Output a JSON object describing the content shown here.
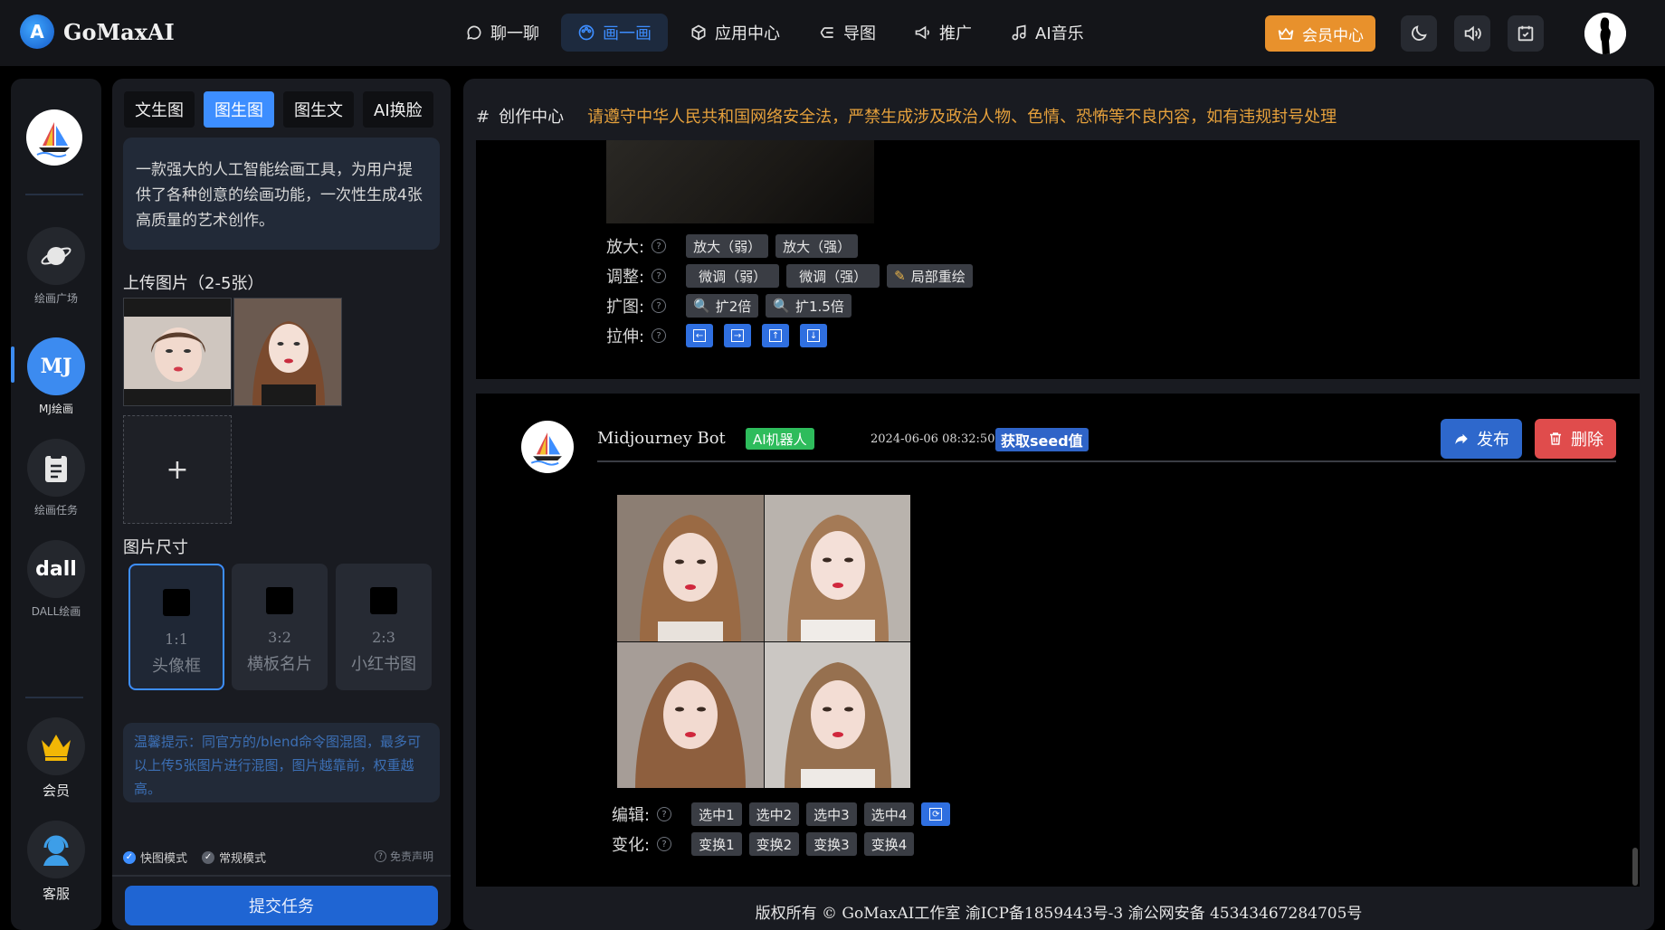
{
  "brand": {
    "name": "GoMaxAI"
  },
  "nav": {
    "items": [
      {
        "label": "聊一聊",
        "icon": "chat-icon"
      },
      {
        "label": "画一画",
        "icon": "palette-icon",
        "active": true
      },
      {
        "label": "应用中心",
        "icon": "cube-icon"
      },
      {
        "label": "导图",
        "icon": "mindmap-icon"
      },
      {
        "label": "推广",
        "icon": "megaphone-icon"
      },
      {
        "label": "AI音乐",
        "icon": "music-icon"
      }
    ],
    "vip_label": "会员中心"
  },
  "rail": {
    "items": [
      {
        "label": "绘画广场",
        "icon": "planet-icon"
      },
      {
        "label": "MJ绘画",
        "text": "MJ",
        "active": true
      },
      {
        "label": "绘画任务",
        "icon": "clipboard-icon"
      },
      {
        "label": "DALL绘画",
        "text": "dall"
      },
      {
        "label": "会员",
        "icon": "crown-icon"
      },
      {
        "label": "客服",
        "icon": "support-icon"
      }
    ]
  },
  "panel": {
    "tabs": [
      "文生图",
      "图生图",
      "图生文",
      "AI换脸"
    ],
    "active_tab": 1,
    "intro": "一款强大的人工智能绘画工具，为用户提供了各种创意的绘画功能，一次性生成4张高质量的艺术创作。",
    "upload_title": "上传图片（2-5张）",
    "add_symbol": "+",
    "size_title": "图片尺寸",
    "sizes": [
      {
        "ratio": "1:1",
        "name": "头像框"
      },
      {
        "ratio": "3:2",
        "name": "横板名片"
      },
      {
        "ratio": "2:3",
        "name": "小红书图"
      }
    ],
    "tip": "温馨提示：同官方的/blend命令图混图，最多可以上传5张图片进行混图，图片越靠前，权重越高。",
    "mode_fast": "快图模式",
    "mode_normal": "常规模式",
    "disclaimer": "免责声明",
    "submit": "提交任务"
  },
  "main": {
    "hash": "#",
    "title": "创作中心",
    "warning": "请遵守中华人民共和国网络安全法，严禁生成涉及政治人物、色情、恐怖等不良内容，如有违规封号处理",
    "card1": {
      "rows": [
        {
          "label": "放大:",
          "buttons": [
            "放大（弱）",
            "放大（强）"
          ]
        },
        {
          "label": "调整:",
          "buttons": [
            "微调（弱）",
            "微调（强）",
            "局部重绘"
          ]
        },
        {
          "label": "扩图:",
          "buttons": [
            "扩2倍",
            "扩1.5倍"
          ]
        },
        {
          "label": "拉伸:",
          "arrows": [
            "←",
            "→",
            "↑",
            "↓"
          ]
        }
      ]
    },
    "card2": {
      "bot_name": "Midjourney Bot",
      "ai_badge": "AI机器人",
      "timestamp": "2024-06-06 08:32:50",
      "seed_label": "获取seed值",
      "publish": "发布",
      "delete": "删除",
      "edit_label": "编辑:",
      "edit_buttons": [
        "选中1",
        "选中2",
        "选中3",
        "选中4"
      ],
      "vary_label": "变化:",
      "vary_buttons": [
        "变换1",
        "变换2",
        "变换3",
        "变换4"
      ]
    },
    "footer": "版权所有 © GoMaxAI工作室 渝ICP备1859443号-3 渝公网安备 45343467284705号"
  },
  "colors": {
    "accent": "#3d8eff",
    "warning": "#e6a13c",
    "vip": "#e8912c",
    "danger": "#e04c4c",
    "success": "#2ebc5c"
  }
}
